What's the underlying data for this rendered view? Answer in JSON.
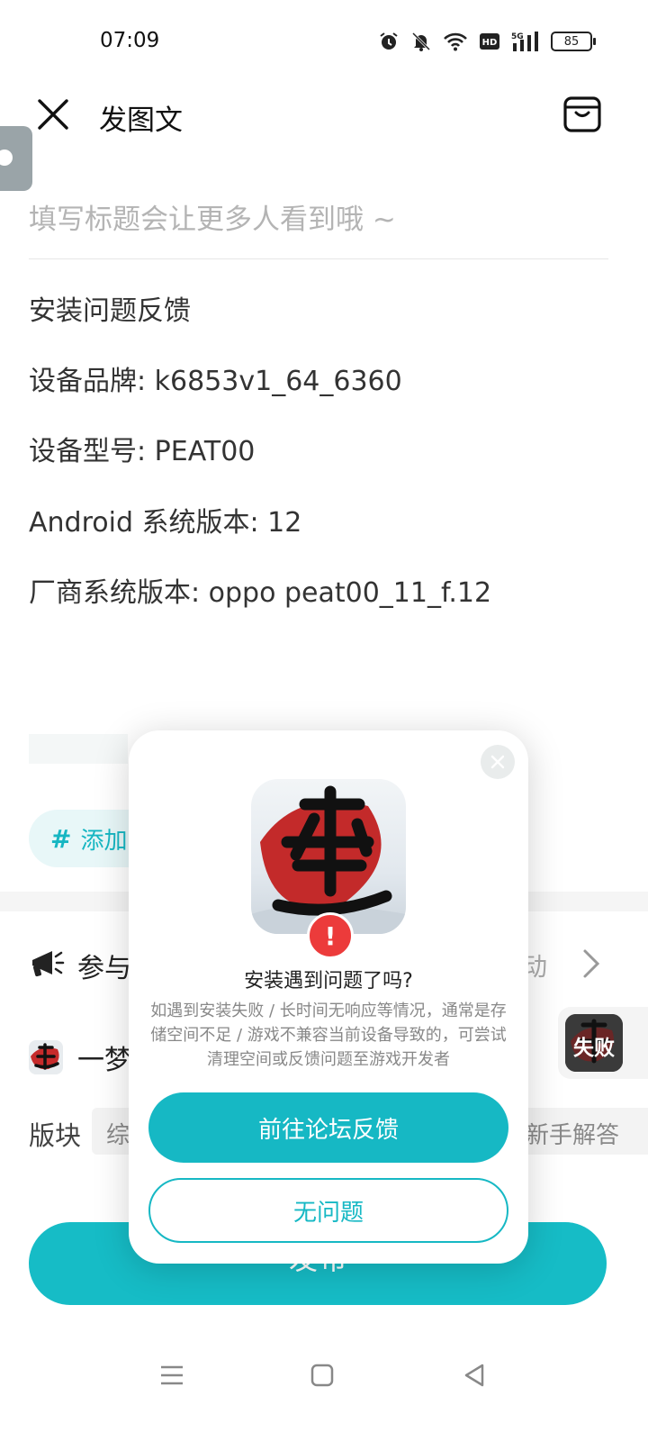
{
  "status_bar": {
    "time": "07:09",
    "battery": "85"
  },
  "header": {
    "title": "发图文"
  },
  "editor": {
    "title_placeholder": "填写标题会让更多人看到哦 ~",
    "body_lines": [
      "安装问题反馈",
      "设备品牌: k6853v1_64_6360",
      "设备型号: PEAT00",
      "Android 系统版本: 12",
      "厂商系统版本: oppo peat00_11_f.12"
    ]
  },
  "topic": {
    "hash": "#",
    "label_partial": "添加"
  },
  "activity": {
    "label_partial": "参与",
    "right_partial": "动"
  },
  "game": {
    "name_partial": "一梦"
  },
  "install_status": {
    "label": "失败"
  },
  "section": {
    "label": "版块",
    "chip_left_partial": "综",
    "chip_right_partial": "新手解答"
  },
  "publish": {
    "label": "发布"
  },
  "dialog": {
    "alert": "!",
    "title": "安装遇到问题了吗?",
    "description": "如遇到安装失败 / 长时间无响应等情况，通常是存储空间不足 / 游戏不兼容当前设备导致的，可尝试清理空间或反馈问题至游戏开发者",
    "primary_label": "前往论坛反馈",
    "secondary_label": "无问题"
  },
  "colors": {
    "accent": "#16b8c4",
    "alert": "#ec3b3b"
  }
}
